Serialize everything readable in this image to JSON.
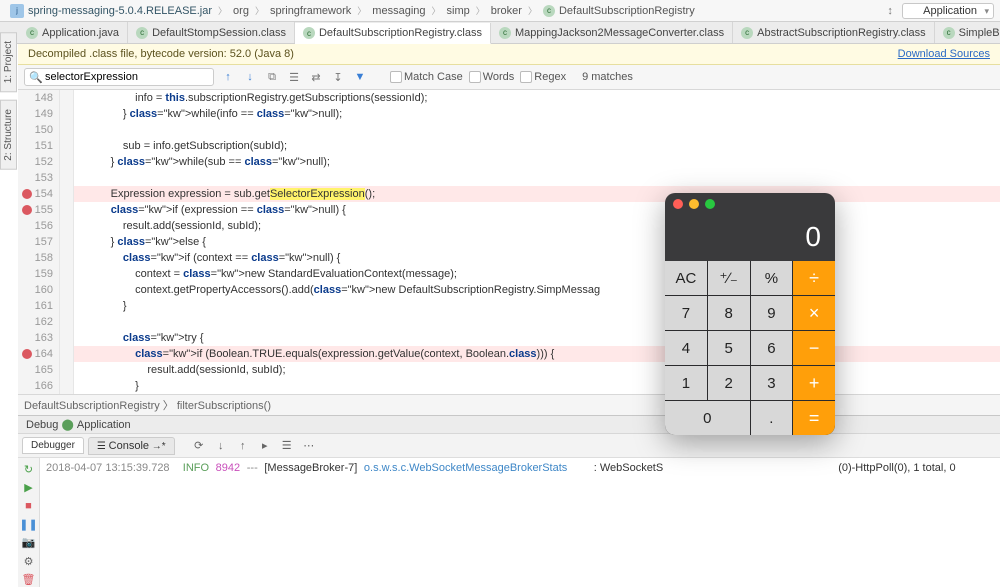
{
  "breadcrumbs": [
    "spring-messaging-5.0.4.RELEASE.jar",
    "org",
    "springframework",
    "messaging",
    "simp",
    "broker",
    "DefaultSubscriptionRegistry"
  ],
  "run_config": {
    "label": "Application",
    "icon": "spring"
  },
  "tool_tabs": {
    "project": "1: Project",
    "structure": "2: Structure"
  },
  "editor_tabs": [
    {
      "label": "Application.java",
      "icon": "c"
    },
    {
      "label": "DefaultStompSession.class",
      "icon": "c"
    },
    {
      "label": "DefaultSubscriptionRegistry.class",
      "icon": "c",
      "active": true
    },
    {
      "label": "MappingJackson2MessageConverter.class",
      "icon": "c"
    },
    {
      "label": "AbstractSubscriptionRegistry.class",
      "icon": "c"
    },
    {
      "label": "SimpleBrokerMessageHandler.class",
      "icon": "c"
    }
  ],
  "notification": {
    "text": "Decompiled .class file, bytecode version: 52.0 (Java 8)",
    "link": "Download Sources"
  },
  "find": {
    "value": "selectorExpression",
    "match_case": "Match Case",
    "words": "Words",
    "regex": "Regex",
    "results": "9 matches"
  },
  "code": {
    "lines": [
      {
        "n": 148,
        "t": "                    info = this.subscriptionRegistry.getSubscriptions(sessionId);"
      },
      {
        "n": 149,
        "t": "                } while(info == null);",
        "kw": [
          "while",
          "null"
        ]
      },
      {
        "n": 150,
        "t": ""
      },
      {
        "n": 151,
        "t": "                sub = info.getSubscription(subId);"
      },
      {
        "n": 152,
        "t": "            } while(sub == null);",
        "kw": [
          "while",
          "null"
        ]
      },
      {
        "n": 153,
        "t": ""
      },
      {
        "n": 154,
        "t": "            Expression expression = sub.getSelectorExpression();",
        "bp": true,
        "err": true,
        "hl": "SelectorExpression"
      },
      {
        "n": 155,
        "t": "            if (expression == null) {",
        "bp": true,
        "kw": [
          "if",
          "null"
        ]
      },
      {
        "n": 156,
        "t": "                result.add(sessionId, subId);"
      },
      {
        "n": 157,
        "t": "            } else {",
        "kw": [
          "else"
        ]
      },
      {
        "n": 158,
        "t": "                if (context == null) {",
        "kw": [
          "if",
          "null"
        ]
      },
      {
        "n": 159,
        "t": "                    context = new StandardEvaluationContext(message);",
        "kw": [
          "new"
        ]
      },
      {
        "n": 160,
        "t": "                    context.getPropertyAccessors().add(new DefaultSubscriptionRegistry.SimpMessag",
        "kw": [
          "new"
        ]
      },
      {
        "n": 161,
        "t": "                }"
      },
      {
        "n": 162,
        "t": ""
      },
      {
        "n": 163,
        "t": "                try {",
        "kw": [
          "try"
        ]
      },
      {
        "n": 164,
        "t": "                    if (Boolean.TRUE.equals(expression.getValue(context, Boolean.class))) {",
        "bp": true,
        "err": true,
        "kw": [
          "if",
          "class"
        ]
      },
      {
        "n": 165,
        "t": "                        result.add(sessionId, subId);"
      },
      {
        "n": 166,
        "t": "                    }"
      }
    ]
  },
  "crumb": {
    "class": "DefaultSubscriptionRegistry",
    "method": "filterSubscriptions()"
  },
  "debug": {
    "title": "Debug",
    "app": "Application",
    "tab_debugger": "Debugger",
    "tab_console": "Console"
  },
  "console_log": {
    "ts": "2018-04-07 13:15:39.728",
    "level": "INFO",
    "pid": "8942",
    "thread": "[MessageBroker-7]",
    "cls": "o.s.w.s.c.WebSocketMessageBrokerStats",
    "tail": ": WebSocketS",
    "after_calc": "(0)-HttpPoll(0), 1 total, 0 "
  },
  "calculator": {
    "display": "0",
    "buttons": [
      {
        "l": "AC",
        "c": "fn"
      },
      {
        "l": "⁺∕₋",
        "c": "fn"
      },
      {
        "l": "%",
        "c": "fn"
      },
      {
        "l": "÷",
        "c": "op"
      },
      {
        "l": "7"
      },
      {
        "l": "8"
      },
      {
        "l": "9"
      },
      {
        "l": "×",
        "c": "op"
      },
      {
        "l": "4"
      },
      {
        "l": "5"
      },
      {
        "l": "6"
      },
      {
        "l": "−",
        "c": "op"
      },
      {
        "l": "1"
      },
      {
        "l": "2"
      },
      {
        "l": "3"
      },
      {
        "l": "+",
        "c": "op"
      },
      {
        "l": "0",
        "c": "zero"
      },
      {
        "l": "."
      },
      {
        "l": "=",
        "c": "op"
      }
    ]
  }
}
